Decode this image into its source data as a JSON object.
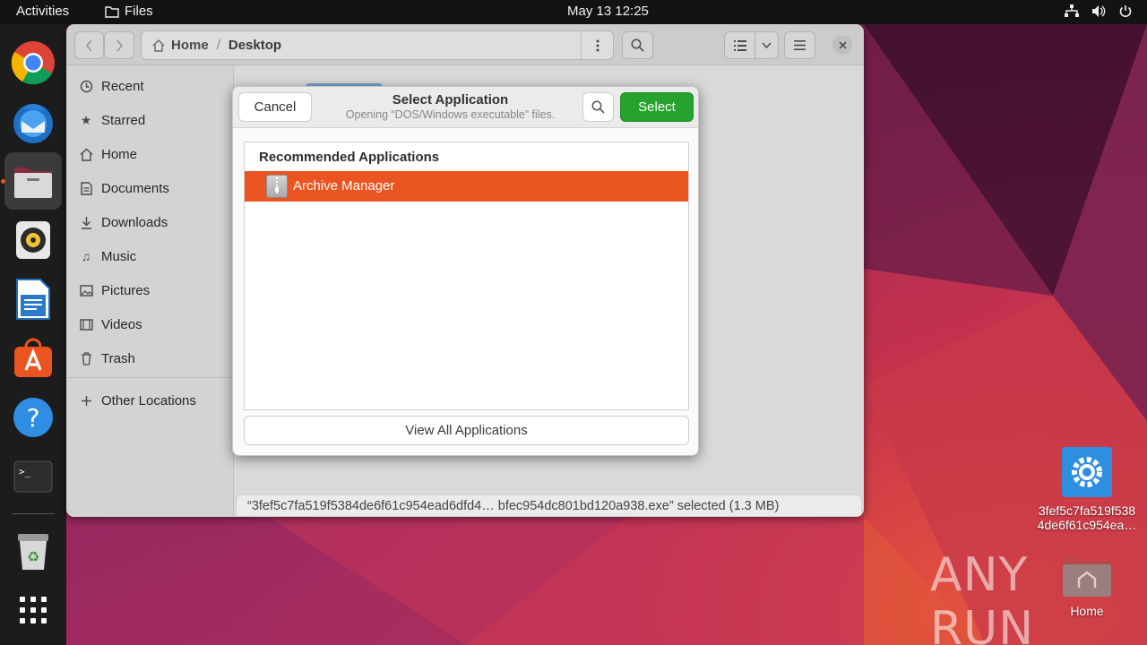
{
  "topbar": {
    "activities": "Activities",
    "app_name": "Files",
    "clock": "May 13  12:25"
  },
  "files_window": {
    "path": {
      "home": "Home",
      "separator": "/",
      "current": "Desktop"
    },
    "sidebar": [
      {
        "label": "Recent",
        "icon": "clock-icon"
      },
      {
        "label": "Starred",
        "icon": "star-icon"
      },
      {
        "label": "Home",
        "icon": "home-icon"
      },
      {
        "label": "Documents",
        "icon": "document-icon"
      },
      {
        "label": "Downloads",
        "icon": "download-icon"
      },
      {
        "label": "Music",
        "icon": "music-icon"
      },
      {
        "label": "Pictures",
        "icon": "picture-icon"
      },
      {
        "label": "Videos",
        "icon": "video-icon"
      },
      {
        "label": "Trash",
        "icon": "trash-icon"
      },
      {
        "label": "Other Locations",
        "icon": "plus-icon"
      }
    ],
    "status": "“3fef5c7fa519f5384de6f61c954ead6dfd4…  bfec954dc801bd120a938.exe” selected  (1.3 MB)"
  },
  "dialog": {
    "cancel": "Cancel",
    "title": "Select Application",
    "subtitle": "Opening “DOS/Windows executable” files.",
    "select": "Select",
    "section": "Recommended Applications",
    "apps": [
      {
        "label": "Archive Manager",
        "selected": true
      }
    ],
    "view_all": "View All Applications"
  },
  "desktop": {
    "file_icon_label_1": "3fef5c7fa519f538",
    "file_icon_label_2": "4de6f61c954ea…",
    "home_label": "Home",
    "watermark": "ANY RUN"
  },
  "colors": {
    "accent": "#e95420",
    "select_button": "#26a22e"
  }
}
